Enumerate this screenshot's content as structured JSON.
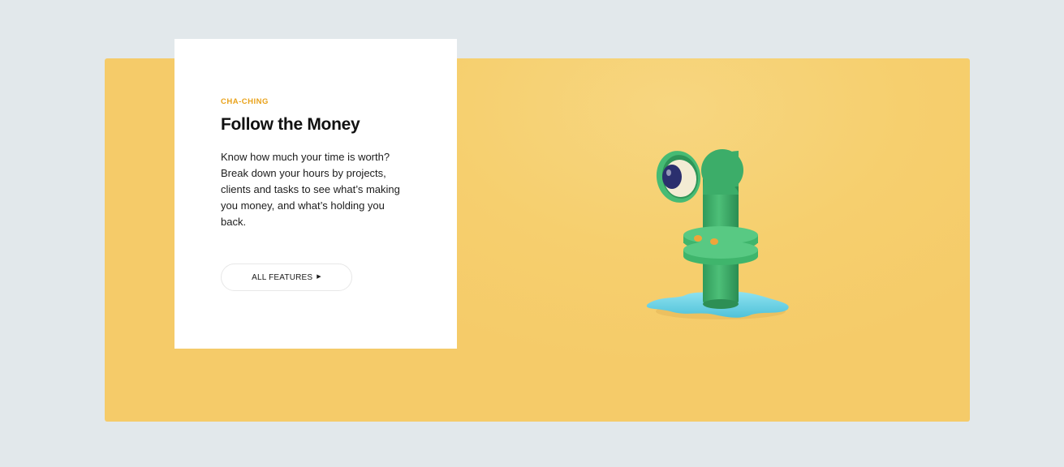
{
  "feature": {
    "eyebrow": "CHA-CHING",
    "title": "Follow the Money",
    "description": "Know how much your time is worth? Break down your hours by projects, clients and tasks to see what’s making you money, and what’s holding you back.",
    "button_label": "ALL FEATURES",
    "button_icon": "triangle-right-icon"
  },
  "illustration": {
    "subject": "green-periscope-pipe-with-eye"
  },
  "colors": {
    "page_background": "#e2e8eb",
    "panel_background": "#f6cf6e",
    "eyebrow": "#e9a21a",
    "pipe_green": "#3db06a",
    "puddle_blue": "#6fd3e6"
  }
}
